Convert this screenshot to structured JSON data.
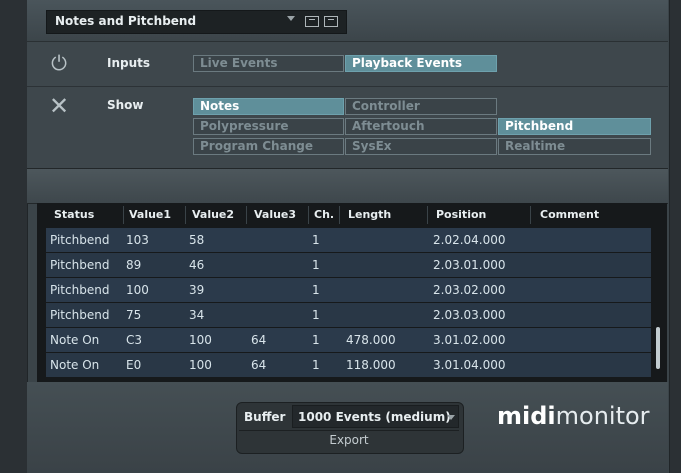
{
  "preset": {
    "name": "Notes and Pitchbend"
  },
  "inputs": {
    "label": "Inputs",
    "buttons": [
      {
        "label": "Live Events",
        "active": false
      },
      {
        "label": "Playback Events",
        "active": true
      }
    ]
  },
  "show": {
    "label": "Show",
    "buttons": [
      {
        "label": "Notes",
        "active": true
      },
      {
        "label": "Controller",
        "active": false
      },
      {
        "label": "Polypressure",
        "active": false
      },
      {
        "label": "Aftertouch",
        "active": false
      },
      {
        "label": "Pitchbend",
        "active": true
      },
      {
        "label": "Program Change",
        "active": false
      },
      {
        "label": "SysEx",
        "active": false
      },
      {
        "label": "Realtime",
        "active": false
      }
    ]
  },
  "table": {
    "columns": [
      "Status",
      "Value1",
      "Value2",
      "Value3",
      "Ch.",
      "Length",
      "Position",
      "Comment"
    ],
    "rows": [
      [
        "Pitchbend",
        "103",
        "58",
        "",
        "1",
        "",
        "2.02.04.000",
        ""
      ],
      [
        "Pitchbend",
        "89",
        "46",
        "",
        "1",
        "",
        "2.03.01.000",
        ""
      ],
      [
        "Pitchbend",
        "100",
        "39",
        "",
        "1",
        "",
        "2.03.02.000",
        ""
      ],
      [
        "Pitchbend",
        "75",
        "34",
        "",
        "1",
        "",
        "2.03.03.000",
        ""
      ],
      [
        "Note On",
        "C3",
        "100",
        "64",
        "1",
        "478.000",
        "3.01.02.000",
        ""
      ],
      [
        "Note On",
        "E0",
        "100",
        "64",
        "1",
        "118.000",
        "3.01.04.000",
        ""
      ]
    ]
  },
  "buffer": {
    "label": "Buffer",
    "value": "1000 Events (medium)",
    "export_label": "Export"
  },
  "brand": {
    "bold": "midi",
    "light": "monitor"
  },
  "colors": {
    "active_button": "#5f8f9a",
    "row_bg": "#2b3a4b",
    "panel": "#3e474c"
  }
}
